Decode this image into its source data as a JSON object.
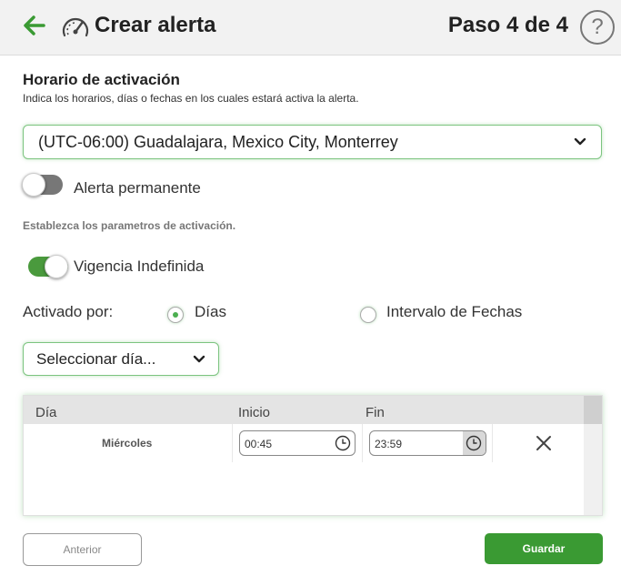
{
  "header": {
    "back_icon": "arrow-left-icon",
    "icon": "speedometer-icon",
    "title": "Crear alerta",
    "step": "Paso 4 de 4",
    "help_label": "?"
  },
  "schedule": {
    "title": "Horario de activación",
    "description": "Indica los horarios, días o fechas en los cuales estará activa la alerta.",
    "timezone_value": "(UTC-06:00) Guadalajara, Mexico City, Monterrey"
  },
  "permanent_alert": {
    "label": "Alerta permanente",
    "enabled": false
  },
  "params_label": "Establezca los parametros de activación.",
  "indefinite_validity": {
    "label": "Vigencia Indefinida",
    "enabled": true
  },
  "activation": {
    "label": "Activado por:",
    "options": [
      {
        "label": "Días",
        "checked": true
      },
      {
        "label": "Intervalo de Fechas",
        "checked": false
      }
    ]
  },
  "day_select": {
    "value": "Seleccionar día..."
  },
  "table": {
    "headers": {
      "day": "Día",
      "start": "Inicio",
      "end": "Fin"
    },
    "rows": [
      {
        "day": "Miércoles",
        "start": "00:45",
        "end": "23:59"
      }
    ]
  },
  "footer": {
    "prev_label": "Anterior",
    "save_label": "Guardar"
  },
  "colors": {
    "accent_green": "#3a9a33",
    "toggle_on": "#4a9a3d",
    "toggle_off": "#777777"
  }
}
